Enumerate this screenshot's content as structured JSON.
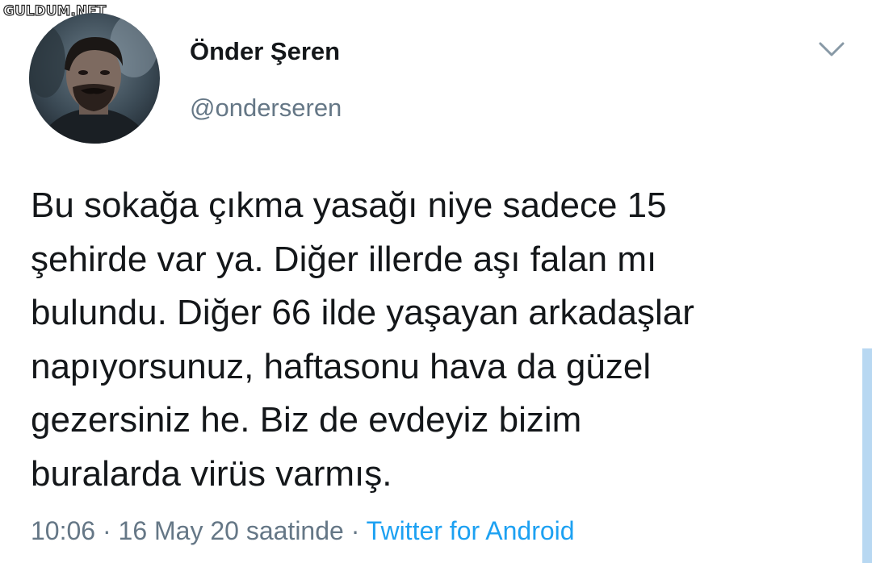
{
  "watermark": "GULDUM.NET",
  "author": {
    "display_name": "Önder Şeren",
    "handle": "@onderseren",
    "avatar_icon": "profile-photo"
  },
  "menu_icon": "chevron-down-icon",
  "tweet": {
    "text_lines": [
      "Bu sokağa çıkma yasağı niye sadece 15",
      "şehirde var ya. Diğer illerde aşı falan mı",
      "bulundu. Diğer 66 ilde yaşayan arkadaşlar",
      "napıyorsunuz, haftasonu hava da güzel",
      "gezersiniz he. Biz de evdeyiz bizim",
      "buralarda virüs varmış."
    ],
    "time": "10:06",
    "separator": "·",
    "date": "16 May 20 saatinde",
    "source": "Twitter for Android"
  },
  "colors": {
    "text": "#14171a",
    "secondary": "#657786",
    "link": "#1da1f2",
    "scrollbar": "#b8d8f2"
  }
}
